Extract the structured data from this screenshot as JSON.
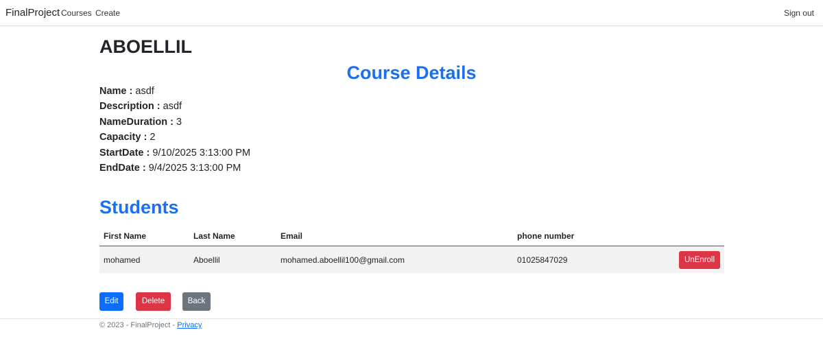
{
  "nav": {
    "brand": "FinalProject",
    "links": [
      "Courses",
      "Create"
    ],
    "signout": "Sign out"
  },
  "page": {
    "user_name": "ABOELLIL",
    "title": "Course Details"
  },
  "details": [
    {
      "label": "Name :",
      "value": "asdf"
    },
    {
      "label": "Description :",
      "value": "asdf"
    },
    {
      "label": "NameDuration :",
      "value": "3"
    },
    {
      "label": "Capacity :",
      "value": "2"
    },
    {
      "label": "StartDate :",
      "value": "9/10/2025 3:13:00 PM"
    },
    {
      "label": "EndDate :",
      "value": "9/4/2025 3:13:00 PM"
    }
  ],
  "students": {
    "title": "Students",
    "columns": [
      "First Name",
      "Last Name",
      "Email",
      "phone number"
    ],
    "rows": [
      {
        "first_name": "mohamed",
        "last_name": "Aboellil",
        "email": "mohamed.aboellil100@gmail.com",
        "phone": "01025847029",
        "action": "UnEnroll"
      }
    ]
  },
  "actions": {
    "edit": "Edit",
    "delete": "Delete",
    "back": "Back"
  },
  "footer": {
    "text": "© 2023 - FinalProject - ",
    "privacy": "Privacy"
  },
  "colors": {
    "primary": "#0d6efd",
    "heading_blue": "#1b6ff0",
    "danger": "#dc3545",
    "secondary": "#6c757d"
  }
}
